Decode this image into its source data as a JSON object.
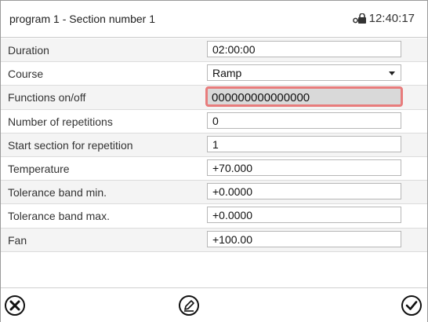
{
  "header": {
    "title": "program 1 - Section number 1",
    "time": "12:40:17",
    "lock_icon": "lock-icon"
  },
  "rows": [
    {
      "label": "Duration",
      "value": "02:00:00"
    },
    {
      "label": "Course",
      "value": "Ramp",
      "dropdown": true
    },
    {
      "label": "Functions on/off",
      "value": "000000000000000",
      "selected": true
    },
    {
      "label": "Number of repetitions",
      "value": "0"
    },
    {
      "label": "Start section for repetition",
      "value": "1"
    },
    {
      "label": "Temperature",
      "value": "+70.000"
    },
    {
      "label": "Tolerance band min.",
      "value": "+0.0000"
    },
    {
      "label": "Tolerance band max.",
      "value": "+0.0000"
    },
    {
      "label": "Fan",
      "value": "+100.00"
    }
  ],
  "footer": {
    "cancel_icon": "cancel-icon",
    "edit_icon": "edit-icon",
    "confirm_icon": "confirm-icon"
  },
  "colors": {
    "highlight_border": "#e87c7c",
    "highlight_fill": "#d9d9d9"
  }
}
